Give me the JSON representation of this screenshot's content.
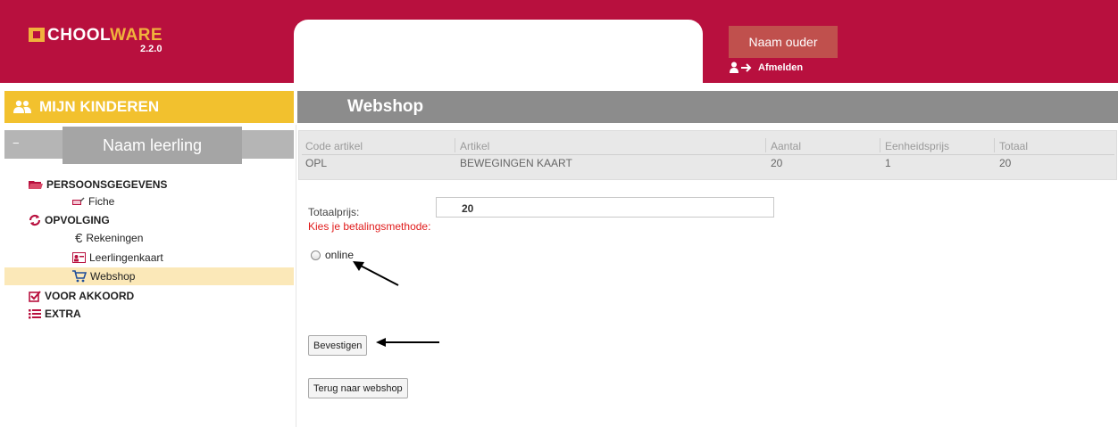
{
  "header": {
    "logo_text_a": "CHOOL",
    "logo_text_b": "WARE",
    "logo_version": "2.2.0",
    "parent_name": "Naam ouder",
    "logout_label": "Afmelden"
  },
  "sidebar": {
    "title": "MIJN KINDEREN",
    "student_name": "Naam leerling",
    "items": [
      {
        "label": "PERSOONSGEGEVENS",
        "icon": "folder-icon"
      },
      {
        "label": "Fiche",
        "icon": "card-icon"
      },
      {
        "label": "OPVOLGING",
        "icon": "refresh-icon"
      },
      {
        "label": "Rekeningen",
        "icon": "euro-icon"
      },
      {
        "label": "Leerlingenkaart",
        "icon": "id-card-icon"
      },
      {
        "label": "Webshop",
        "icon": "cart-icon"
      },
      {
        "label": "VOOR AKKOORD",
        "icon": "checkbox-icon"
      },
      {
        "label": "EXTRA",
        "icon": "list-icon"
      }
    ]
  },
  "main": {
    "title": "Webshop",
    "table": {
      "headers": [
        "Code artikel",
        "Artikel",
        "Aantal",
        "Eenheidsprijs",
        "Totaal"
      ],
      "rows": [
        [
          "OPL",
          "BEWEGINGEN KAART",
          "20",
          "1",
          "20"
        ]
      ]
    },
    "total_label": "Totaalprijs:",
    "total_value": "20",
    "payment_label": "Kies je betalingsmethode:",
    "payment_option": "online",
    "confirm_button": "Bevestigen",
    "back_button": "Terug naar webshop"
  },
  "colors": {
    "header_bg": "#b8103e",
    "sidebar_head": "#f2c12e",
    "title_bar": "#8c8c8c",
    "accent_orange": "#f0b23c",
    "error_red": "#e01b1b"
  }
}
